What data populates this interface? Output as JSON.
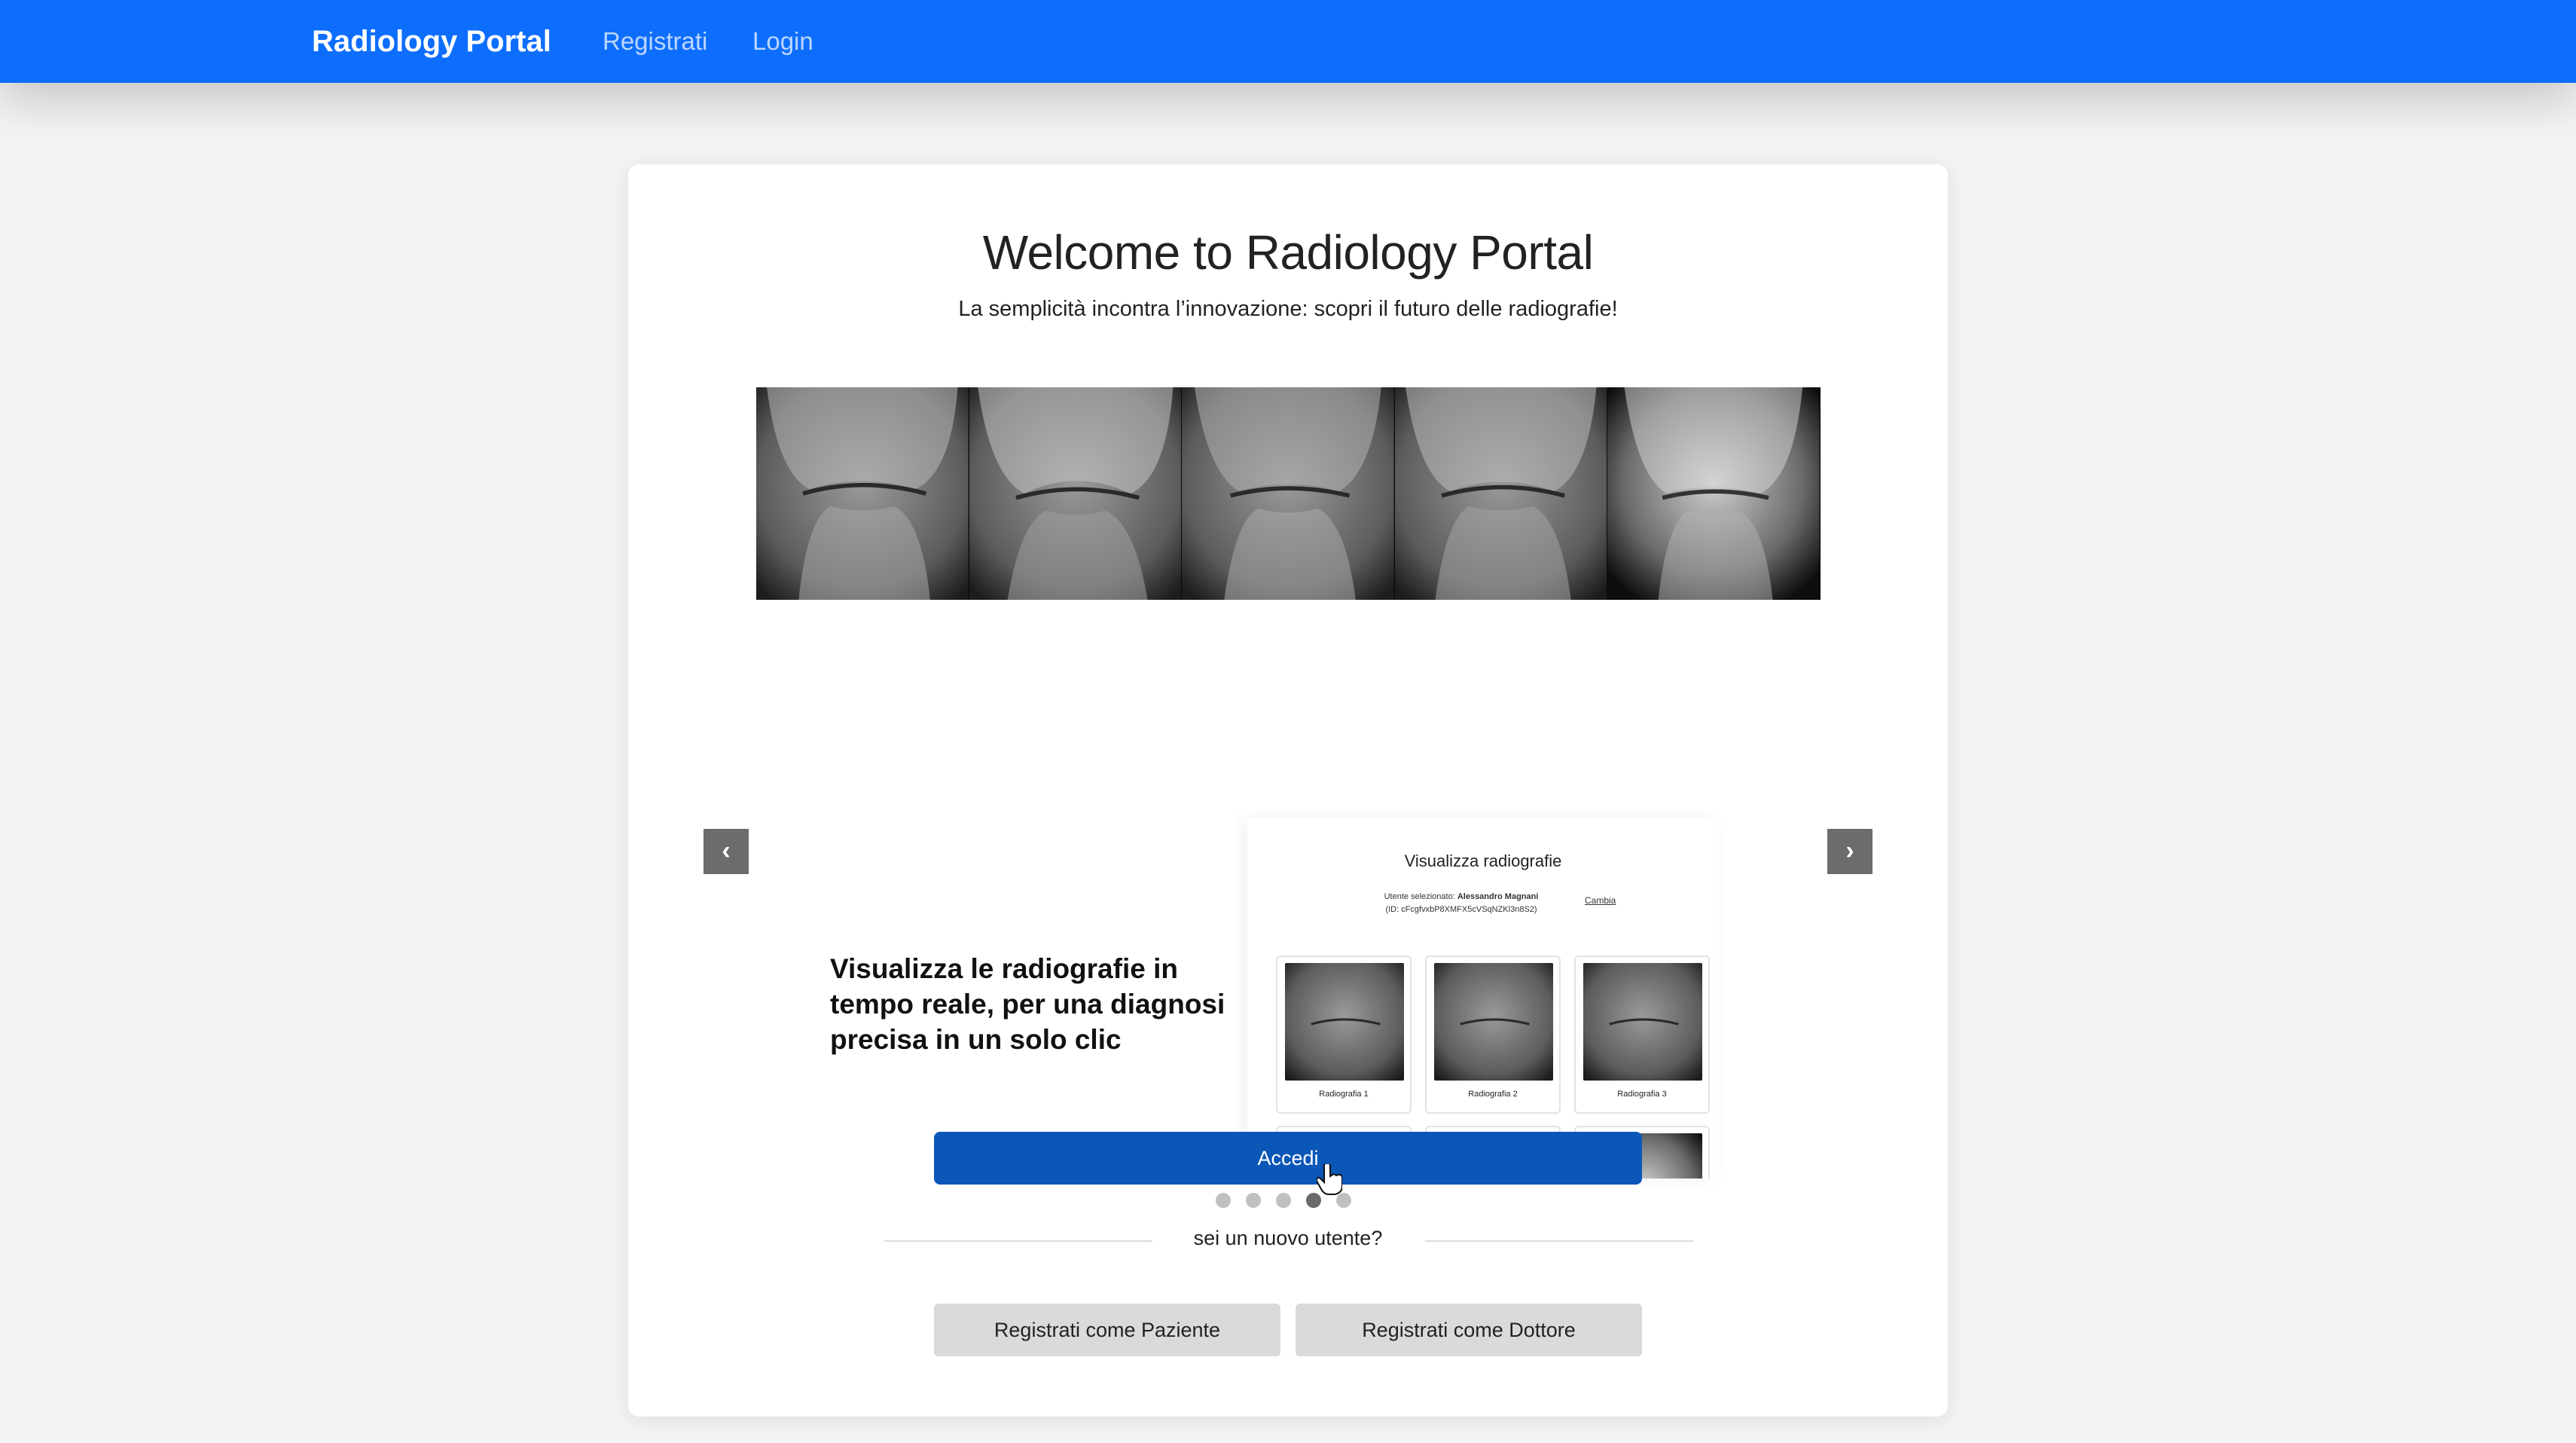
{
  "navbar": {
    "brand": "Radiology Portal",
    "links": [
      "Registrati",
      "Login"
    ],
    "color": "#0d6efd"
  },
  "hero": {
    "title": "Welcome to Radiology Portal",
    "subtitle": "La semplicità incontra l’innovazione: scopri il futuro delle radiografie!"
  },
  "carousel": {
    "prev_icon": "chevron-left-icon",
    "next_icon": "chevron-right-icon",
    "prev_glyph": "‹",
    "next_glyph": "›",
    "caption": "Visualizza le radiografie in tempo reale, per una diagnosi precisa in un solo clic",
    "active_index": 3,
    "dot_count": 5,
    "preview": {
      "title": "Visualizza radiografie",
      "user_label": "Utente selezionato:",
      "user_name": "Alessandro Magnani",
      "user_id": "(ID: cFcgfvxbP8XMFX5cVSqNZKl3n8S2)",
      "change_link": "Cambia",
      "cards": [
        "Radiografia 1",
        "Radiografia 2",
        "Radiografia 3"
      ]
    }
  },
  "actions": {
    "login_button": "Accedi",
    "new_user_prompt": "sei un nuovo utente?",
    "register_patient": "Registrati come Paziente",
    "register_doctor": "Registrati come Dottore",
    "primary_color": "#0b57b8"
  }
}
